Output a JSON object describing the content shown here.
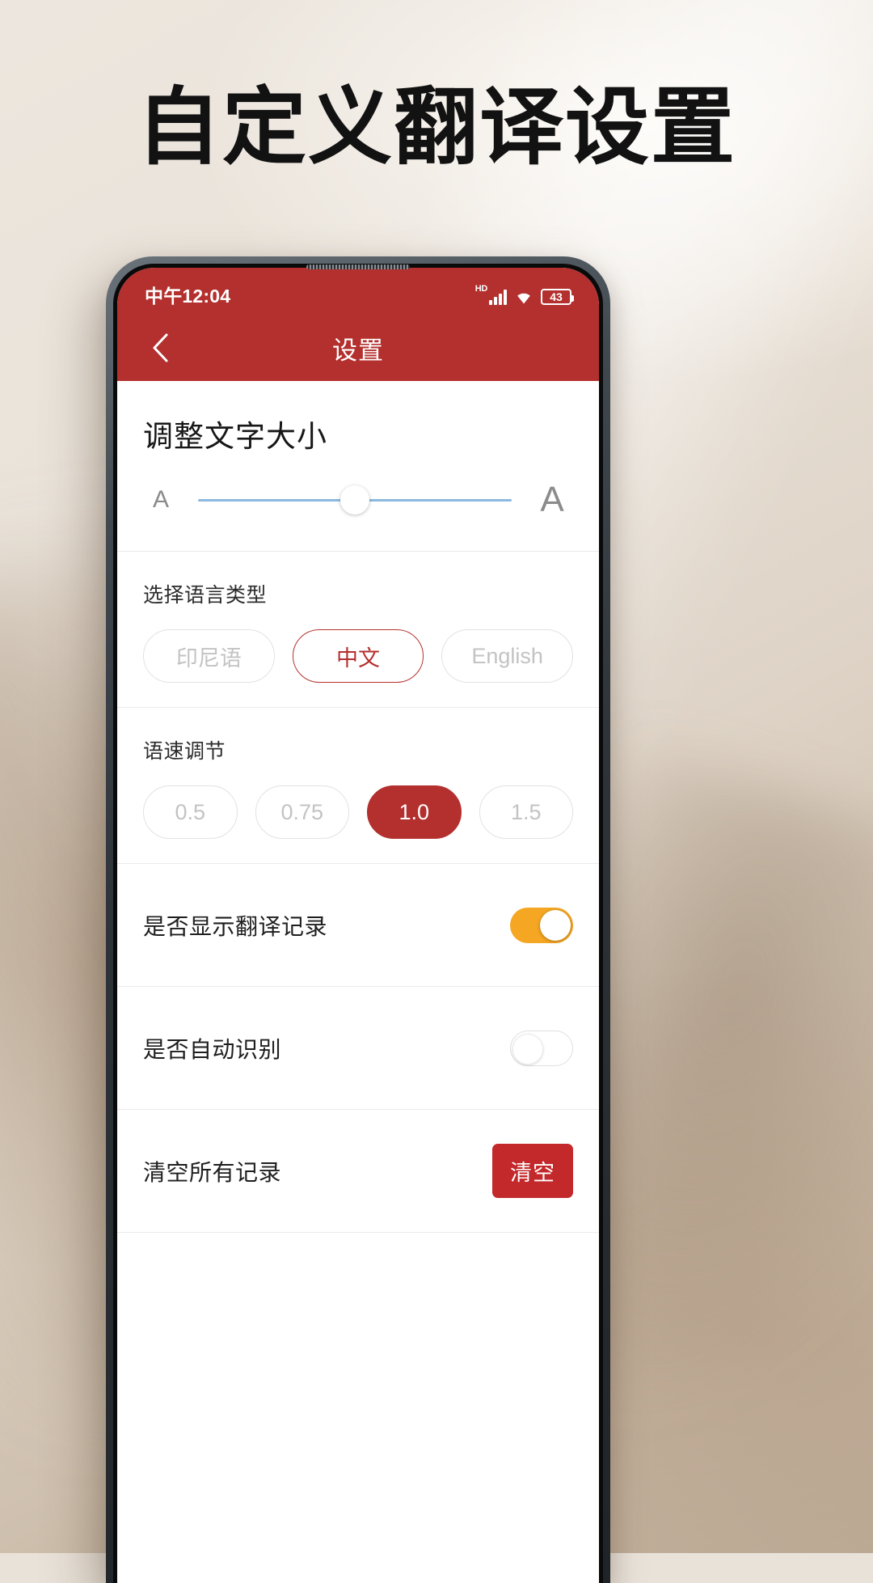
{
  "page": {
    "headline": "自定义翻译设置"
  },
  "phone": {
    "statusbar": {
      "time": "中午12:04",
      "hd_label": "HD",
      "battery_level": "43",
      "icons": [
        "hd-icon",
        "signal-bars-icon",
        "wifi-icon",
        "battery-icon"
      ]
    },
    "appbar": {
      "back_icon": "chevron-left-icon",
      "title": "设置"
    },
    "sections": {
      "font_size": {
        "title": "调整文字大小",
        "small_label": "A",
        "large_label": "A",
        "value_percent": 50
      },
      "language": {
        "title": "选择语言类型",
        "options": [
          {
            "label": "印尼语",
            "state": "unselected"
          },
          {
            "label": "中文",
            "state": "selected-outline"
          },
          {
            "label": "English",
            "state": "unselected"
          }
        ]
      },
      "speed": {
        "title": "语速调节",
        "options": [
          {
            "label": "0.5",
            "state": "unselected"
          },
          {
            "label": "0.75",
            "state": "unselected"
          },
          {
            "label": "1.0",
            "state": "selected-filled"
          },
          {
            "label": "1.5",
            "state": "unselected"
          }
        ]
      },
      "show_history": {
        "label": "是否显示翻译记录",
        "toggle_state": "on"
      },
      "auto_detect": {
        "label": "是否自动识别",
        "toggle_state": "off"
      },
      "clear_records": {
        "label": "清空所有记录",
        "button_label": "清空"
      }
    }
  },
  "colors": {
    "brand_red": "#b3302e",
    "clear_button_red": "#c3282b",
    "toggle_on": "#f5a623",
    "slider_track": "#8cb9e0",
    "background_beige": "#e9e2d9"
  }
}
